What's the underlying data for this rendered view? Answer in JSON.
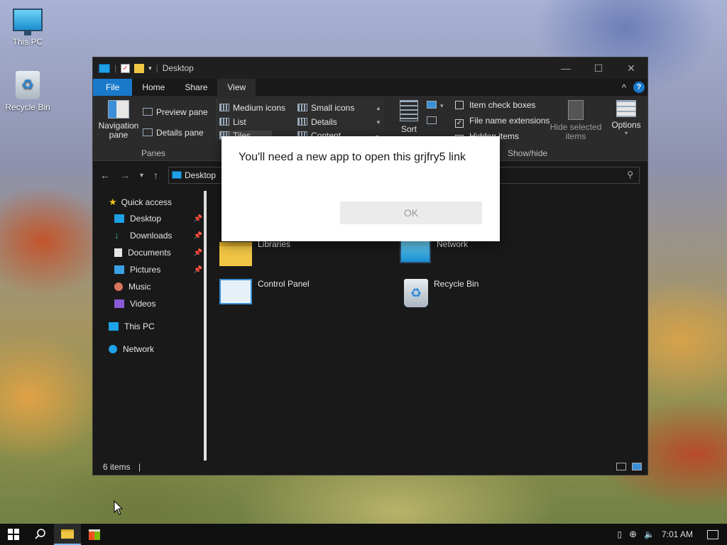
{
  "desktop": {
    "icons": [
      {
        "label": "This PC",
        "icon": "monitor-icon"
      },
      {
        "label": "Recycle Bin",
        "icon": "recycle-bin-icon"
      }
    ]
  },
  "window": {
    "title": "Desktop",
    "controls": {
      "minimize": "—",
      "maximize": "☐",
      "close": "✕"
    },
    "tabs": [
      "File",
      "Home",
      "Share",
      "View"
    ],
    "active_tab": "View",
    "help": "?",
    "collapse": "^"
  },
  "ribbon": {
    "panes": {
      "navigation_pane": "Navigation pane",
      "preview_pane": "Preview pane",
      "details_pane": "Details pane",
      "group_label": "Panes"
    },
    "layout": {
      "medium_icons": "Medium icons",
      "small_icons": "Small icons",
      "list": "List",
      "details": "Details",
      "tiles": "Tiles",
      "content": "Content"
    },
    "sort": "Sort",
    "show_hide": {
      "item_check_boxes": "Item check boxes",
      "file_name_extensions": "File name extensions",
      "hidden_items": "Hidden items",
      "hide_selected_items": "Hide selected items",
      "group_label": "Show/hide"
    },
    "options": "Options"
  },
  "navigation": {
    "address": "Desktop"
  },
  "nav_pane": {
    "quick_access": "Quick access",
    "items": [
      {
        "label": "Desktop",
        "pinned": true
      },
      {
        "label": "Downloads",
        "pinned": true
      },
      {
        "label": "Documents",
        "pinned": true
      },
      {
        "label": "Pictures",
        "pinned": true
      },
      {
        "label": "Music",
        "pinned": false
      },
      {
        "label": "Videos",
        "pinned": false
      }
    ],
    "this_pc": "This PC",
    "network": "Network"
  },
  "content": {
    "items": [
      {
        "label": "Libraries",
        "icon": "folder-icon"
      },
      {
        "label": "Network",
        "icon": "network-icon"
      },
      {
        "label": "Control Panel",
        "icon": "control-panel-icon"
      },
      {
        "label": "Recycle Bin",
        "icon": "recycle-bin-icon"
      }
    ]
  },
  "status": {
    "count": "6 items"
  },
  "dialog": {
    "message": "You'll need a new app to open this grjfry5 link",
    "ok": "OK"
  },
  "taskbar": {
    "clock": "7:01 AM"
  },
  "colors": {
    "accent": "#1979ca",
    "window_bg": "#191919",
    "ribbon_bg": "#2b2b2b"
  }
}
